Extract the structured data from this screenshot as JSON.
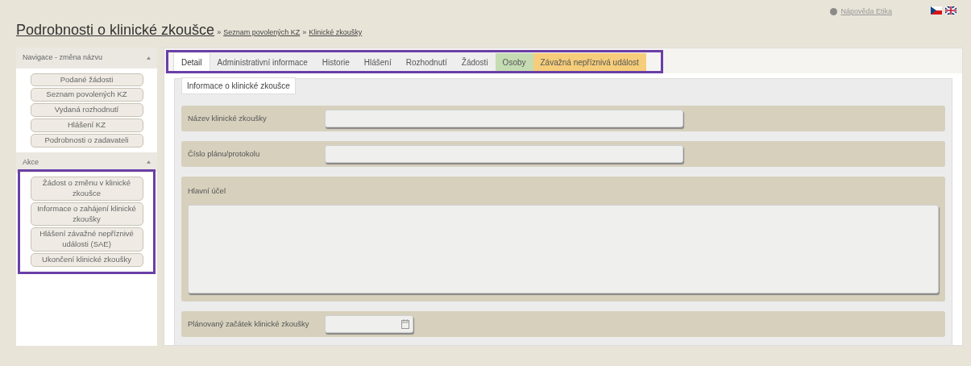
{
  "header": {
    "title": "Podrobnosti o klinické zkoušce",
    "breadcrumbs": [
      "Seznam povolených KZ",
      "Klinické zkoušky"
    ],
    "separator": "»",
    "help_link": "Nápověda Etika"
  },
  "sidebar": {
    "sections": [
      {
        "title": "Navigace - změna názvu",
        "highlighted": false,
        "items": [
          "Podané žádosti",
          "Seznam povolených KZ",
          "Vydaná rozhodnutí",
          "Hlášení KZ",
          "Podrobnosti o zadavateli"
        ]
      },
      {
        "title": "Akce",
        "highlighted": true,
        "items": [
          "Žádost o změnu v klinické zkoušce",
          "Informace o zahájení klinické zkoušky",
          "Hlášení závažné nepříznivé události (SAE)",
          "Ukončení klinické zkoušky"
        ]
      }
    ]
  },
  "tabs": {
    "highlighted": true,
    "items": [
      {
        "label": "Detail",
        "selected": true,
        "color": "#ffffff"
      },
      {
        "label": "Administrativní informace",
        "selected": false,
        "color": "#eeeeee"
      },
      {
        "label": "Historie",
        "selected": false,
        "color": "#eeeeee"
      },
      {
        "label": "Hlášení",
        "selected": false,
        "color": "#eeeeee"
      },
      {
        "label": "Rozhodnutí",
        "selected": false,
        "color": "#eeeeee"
      },
      {
        "label": "Žádosti",
        "selected": false,
        "color": "#eeeeee"
      },
      {
        "label": "Osoby",
        "selected": false,
        "color": "#c5dcb3"
      },
      {
        "label": "Závažná nepříznivá událost",
        "selected": false,
        "color": "#f6cd7a"
      }
    ]
  },
  "form": {
    "legend": "Informace o klinické zkoušce",
    "fields": [
      {
        "kind": "text",
        "label": "Název klinické zkoušky"
      },
      {
        "kind": "text",
        "label": "Číslo plánu/protokolu"
      },
      {
        "kind": "textarea",
        "label": "Hlavní účel"
      },
      {
        "kind": "date",
        "label": "Plánovaný začátek klinické zkoušky"
      }
    ]
  }
}
